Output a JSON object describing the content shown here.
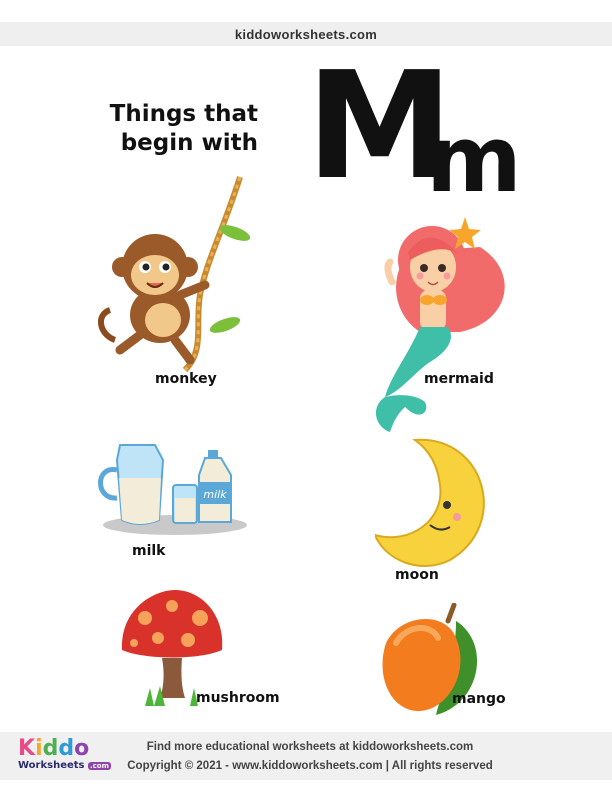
{
  "site": {
    "url": "kiddoworksheets.com"
  },
  "header": {
    "line1": "Things that",
    "line2": "begin with",
    "letter_upper": "M",
    "letter_lower": "m"
  },
  "items": [
    {
      "label": "monkey",
      "icon": "monkey-icon"
    },
    {
      "label": "mermaid",
      "icon": "mermaid-icon"
    },
    {
      "label": "milk",
      "icon": "milk-icon"
    },
    {
      "label": "moon",
      "icon": "moon-icon"
    },
    {
      "label": "mushroom",
      "icon": "mushroom-icon"
    },
    {
      "label": "mango",
      "icon": "mango-icon"
    }
  ],
  "footer": {
    "logo_text": "Kiddo",
    "logo_sub": "Worksheets",
    "logo_suffix": ".com",
    "line1": "Find more educational worksheets at kiddoworksheets.com",
    "line2": "Copyright © 2021 - www.kiddoworksheets.com  |  All rights reserved"
  },
  "colors": {
    "footer_bg": "#f0f0f0",
    "topbar_bg": "#efefef",
    "text": "#111111"
  }
}
